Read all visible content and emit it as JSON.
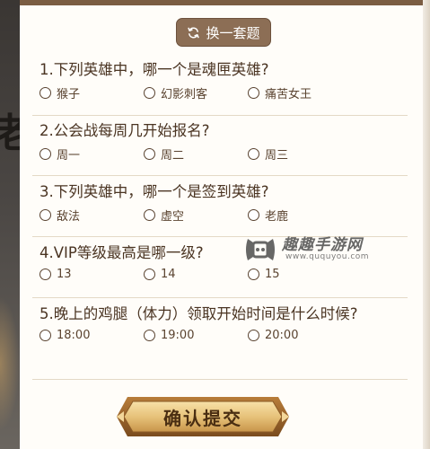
{
  "backdrop_glyph": "老",
  "refresh_button": {
    "label": "换一套题",
    "icon": "refresh-icon"
  },
  "questions": [
    {
      "text": "1.下列英雄中，哪一个是魂匣英雄?",
      "options": [
        "猴子",
        "幻影刺客",
        "痛苦女王"
      ]
    },
    {
      "text": "2.公会战每周几开始报名?",
      "options": [
        "周一",
        "周二",
        "周三"
      ]
    },
    {
      "text": "3.下列英雄中，哪一个是签到英雄?",
      "options": [
        "敌法",
        "虚空",
        "老鹿"
      ]
    },
    {
      "text": "4.VIP等级最高是哪一级?",
      "options": [
        "13",
        "14",
        "15"
      ]
    },
    {
      "text": "5.晚上的鸡腿（体力）领取开始时间是什么时候?",
      "options": [
        "18:00",
        "19:00",
        "20:00"
      ]
    }
  ],
  "submit_button": {
    "label": "确认提交"
  },
  "watermark": {
    "title": "趣趣手游网",
    "url": "www.ququyou.com"
  },
  "colors": {
    "panel_top_bar": "#7b5d43",
    "refresh_button_bg": "#8c6e55",
    "text": "#4a3422",
    "divider": "#e4d9c6",
    "submit_gold": "#e7c27a"
  }
}
